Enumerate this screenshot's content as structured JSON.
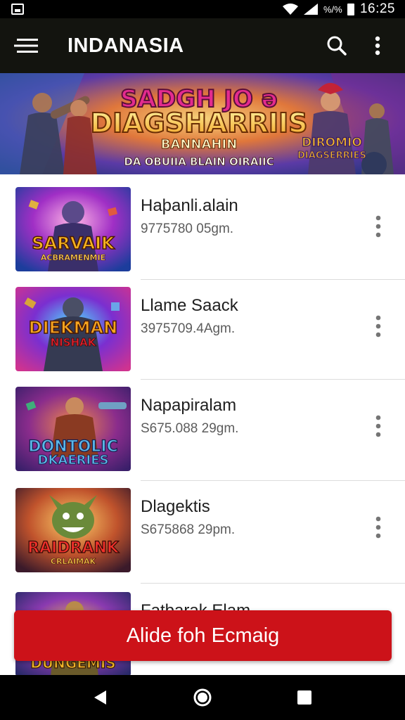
{
  "status_bar": {
    "battery_text": "%/%",
    "time": "16:25",
    "icons": [
      "image-icon",
      "wifi-icon",
      "signal-icon",
      "battery-icon"
    ]
  },
  "app_bar": {
    "title": "INDANASIA",
    "icons": [
      "hamburger-menu-icon",
      "search-icon",
      "more-vert-icon"
    ]
  },
  "banner": {
    "headline_1": "SADGH JO ə",
    "headline_2": "DIAGSHARRIIS",
    "headline_3": "BANNAHIN",
    "tagline": "DA OBUIIA BLAIN OIRAIIC",
    "badge_1": "DIROMIO",
    "badge_2": "DIAGSERRIES"
  },
  "games": [
    {
      "title": "Haþanli.alain",
      "subtitle": "9775780 05gm.",
      "thumb_line_1": "SARVAIK",
      "thumb_line_2": "ACBRAMENMIE"
    },
    {
      "title": "Llame Saack",
      "subtitle": "3975709.4Agm.",
      "thumb_line_1": "DIEKMAN",
      "thumb_line_2": "NISHAK"
    },
    {
      "title": "Napapiralam",
      "subtitle": "S675.088 29gm.",
      "thumb_line_1": "DONTOLIC",
      "thumb_line_2": "DKAERIES"
    },
    {
      "title": "Dlagektis",
      "subtitle": "S675868 29pm.",
      "thumb_line_1": "RAIDRANK",
      "thumb_line_2": "CRLAIMAK"
    },
    {
      "title": "Fatbarak Elam",
      "subtitle": "",
      "thumb_line_1": "DUNGEMIS",
      "thumb_line_2": ""
    }
  ],
  "cta_button": {
    "label": "Alide foh Ecmaig"
  },
  "nav_bar": {
    "icons": [
      "back-icon",
      "home-icon",
      "recents-icon"
    ]
  },
  "colors": {
    "accent": "#cc1219",
    "app_bar": "#13140f",
    "divider": "#dcdcdc"
  }
}
